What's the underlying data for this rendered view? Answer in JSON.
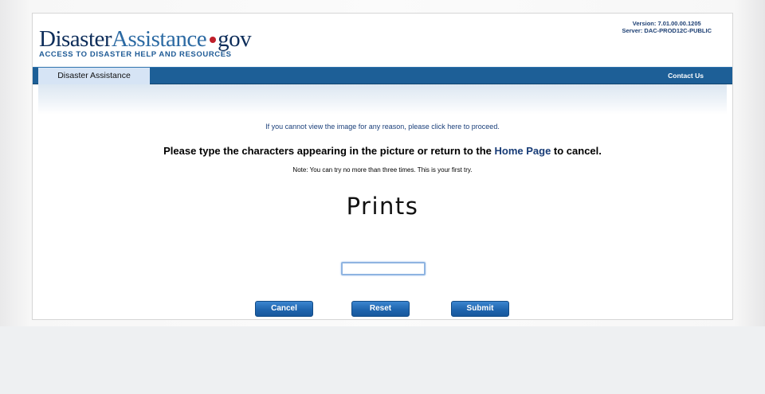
{
  "header": {
    "logo": {
      "part1": "Disaster",
      "part2": "Assistance",
      "part3": "gov"
    },
    "tagline": "ACCESS TO DISASTER HELP AND RESOURCES",
    "version": "Version: 7.01.00.00.1205",
    "server": "Server: DAC-PROD12C-PUBLIC"
  },
  "nav": {
    "tab": "Disaster Assistance",
    "contact": "Contact Us"
  },
  "main": {
    "proceed_note": "If you cannot view the image for any reason, please click here to proceed.",
    "instruction_prefix": "Please type the characters appearing in the picture or return to the ",
    "home_link": "Home Page",
    "instruction_suffix": " to cancel.",
    "attempt_note": "Note: You can try no more than three times. This is your first try.",
    "captcha_text": "Prints",
    "input_value": ""
  },
  "buttons": {
    "cancel": "Cancel",
    "reset": "Reset",
    "submit": "Submit"
  },
  "colors": {
    "nav_bar": "#1d5f97",
    "nav_tab": "#d6e4f5",
    "button": "#1f65ae",
    "logo_dot": "#c0202b"
  }
}
